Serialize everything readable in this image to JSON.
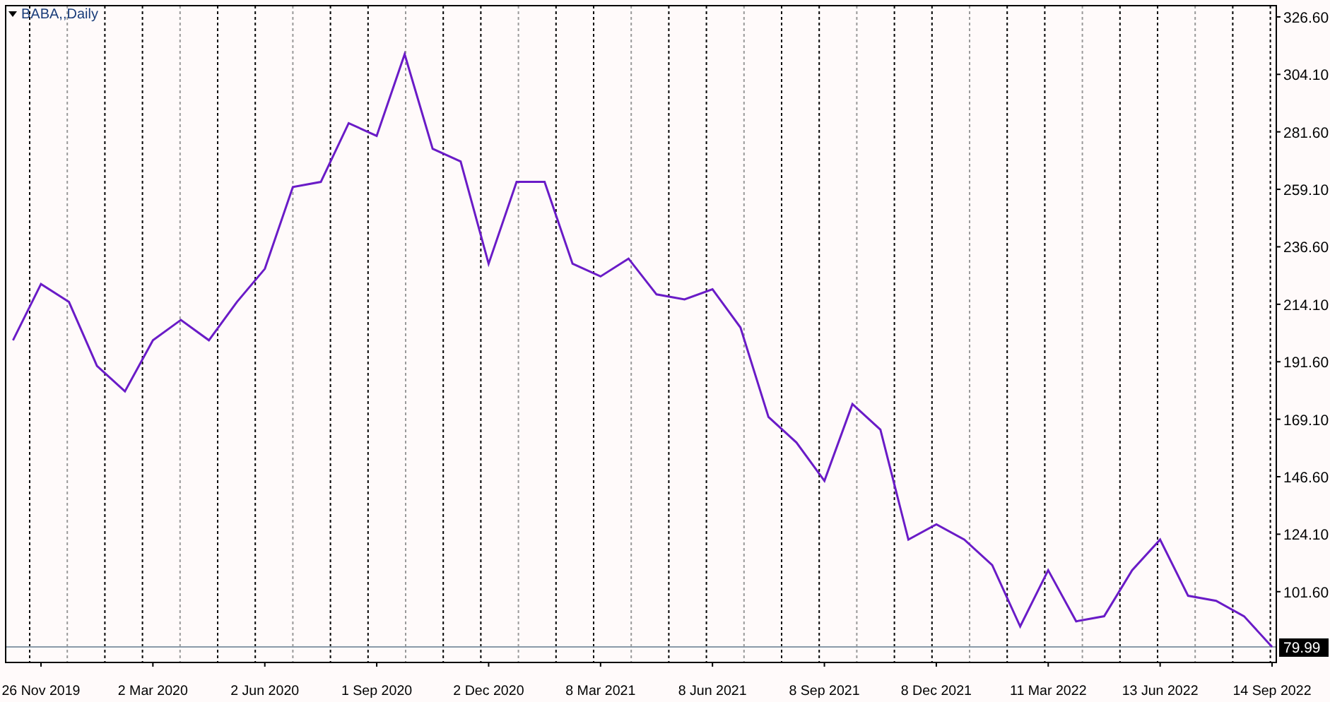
{
  "chart_title": "BABA,,Daily",
  "chart_data": {
    "type": "line",
    "grid": true,
    "categories": [
      null,
      "26 Nov 2019",
      null,
      null,
      null,
      "2 Mar 2020",
      null,
      null,
      null,
      "2 Jun 2020",
      null,
      null,
      null,
      "1 Sep 2020",
      null,
      null,
      null,
      "2 Dec 2020",
      null,
      null,
      null,
      "8 Mar 2021",
      null,
      null,
      null,
      "8 Jun 2021",
      null,
      null,
      null,
      "8 Sep 2021",
      null,
      null,
      null,
      "8 Dec 2021",
      null,
      null,
      null,
      "11 Mar 2022",
      null,
      null,
      null,
      "13 Jun 2022",
      null,
      null,
      null,
      "14 Sep 2022"
    ],
    "series": [
      {
        "color": "#6a1bc7",
        "values": [
          200,
          222,
          215,
          190,
          180,
          200,
          208,
          200,
          215,
          228,
          260,
          262,
          285,
          280,
          312,
          275,
          270,
          230,
          262,
          262,
          230,
          225,
          232,
          218,
          216,
          220,
          205,
          170,
          160,
          145,
          175,
          165,
          122,
          128,
          122,
          112,
          88,
          110,
          90,
          92,
          110,
          122,
          100,
          98,
          92,
          80
        ]
      }
    ],
    "ylim": [
      73.9,
      331
    ],
    "yticks": [
      {
        "value": 326.6,
        "label": "326.60"
      },
      {
        "value": 304.1,
        "label": "304.10"
      },
      {
        "value": 281.6,
        "label": "281.60"
      },
      {
        "value": 259.1,
        "label": "259.10"
      },
      {
        "value": 236.6,
        "label": "236.60"
      },
      {
        "value": 214.1,
        "label": "214.10"
      },
      {
        "value": 191.6,
        "label": "191.60"
      },
      {
        "value": 169.1,
        "label": "169.10"
      },
      {
        "value": 146.6,
        "label": "146.60"
      },
      {
        "value": 124.1,
        "label": "124.10"
      },
      {
        "value": 101.6,
        "label": "101.60"
      }
    ],
    "ref_lines": [
      {
        "axis": "y",
        "value": 79.99,
        "label": "79.99",
        "color": "#8a9aa8"
      }
    ]
  }
}
